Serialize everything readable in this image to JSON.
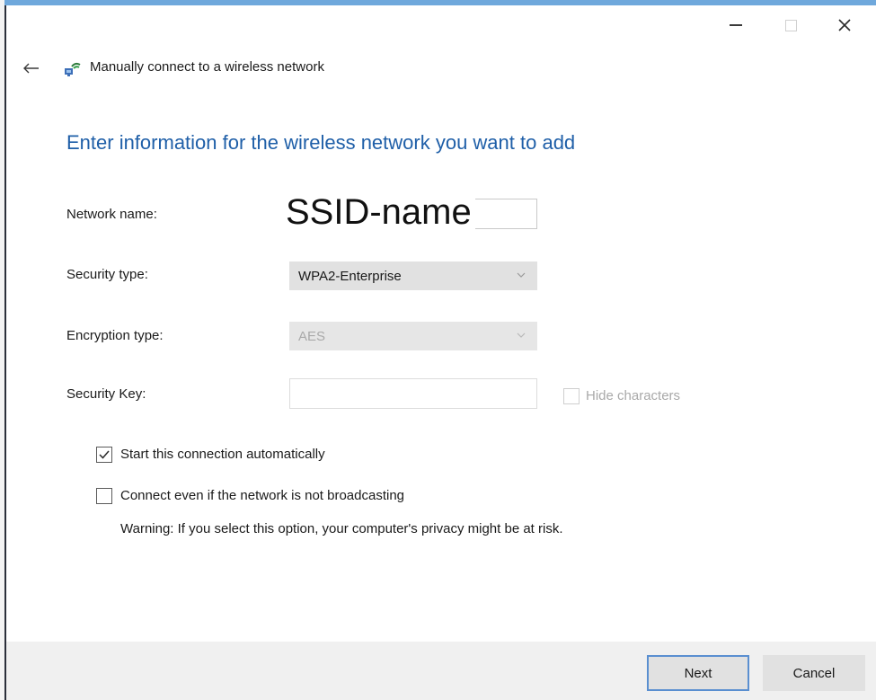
{
  "window": {
    "title": "Manually connect to a wireless network",
    "controls": {
      "minimize": "minimize",
      "maximize": "maximize",
      "close": "close"
    }
  },
  "heading": "Enter information for the wireless network you want to add",
  "form": {
    "network_name": {
      "label": "Network name:",
      "value": "SSID-name"
    },
    "security_type": {
      "label": "Security type:",
      "value": "WPA2-Enterprise"
    },
    "encryption_type": {
      "label": "Encryption type:",
      "value": "AES"
    },
    "security_key": {
      "label": "Security Key:",
      "value": "",
      "hide_characters_label": "Hide characters",
      "hide_characters_checked": false
    }
  },
  "options": {
    "start_automatically": {
      "label": "Start this connection automatically",
      "checked": true
    },
    "connect_not_broadcasting": {
      "label": "Connect even if the network is not broadcasting",
      "checked": false
    },
    "warning": "Warning: If you select this option, your computer's privacy might be at risk."
  },
  "buttons": {
    "next": "Next",
    "cancel": "Cancel"
  },
  "colors": {
    "heading": "#1f5fa8",
    "accent": "#6fa8dc",
    "footer": "#f0f0f0"
  }
}
